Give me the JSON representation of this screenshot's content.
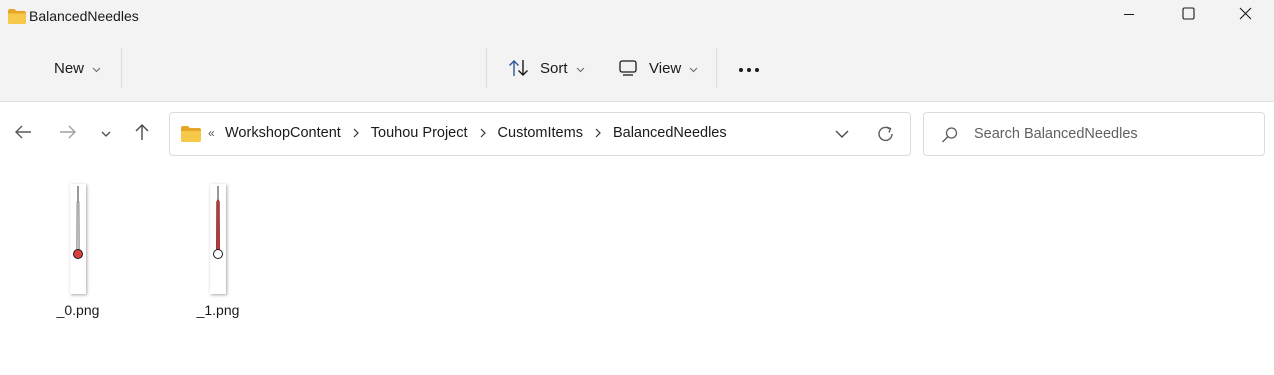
{
  "window": {
    "title": "BalancedNeedles",
    "folder_icon": "folder-icon",
    "controls": [
      "minimize-icon",
      "maximize-icon",
      "close-icon"
    ]
  },
  "commandbar": {
    "new_label": "New",
    "sort_label": "Sort",
    "view_label": "View",
    "more_icon": "more-icon"
  },
  "address": {
    "overflow_marker": "«",
    "breadcrumbs": [
      "WorkshopContent",
      "Touhou Project",
      "CustomItems",
      "BalancedNeedles"
    ]
  },
  "search": {
    "placeholder": "Search BalancedNeedles"
  },
  "files": [
    {
      "name": "_0.png",
      "needle_color": "#e25a5a",
      "ball_color": "#d94040",
      "stem_color": "#333333"
    },
    {
      "name": "_1.png",
      "needle_color": "#b23a3a",
      "ball_color": "#ffffff",
      "stem_color": "#9a2b2b"
    }
  ],
  "colors": {
    "folder": "#f2c14e",
    "chrome": "#f3f3f3"
  }
}
